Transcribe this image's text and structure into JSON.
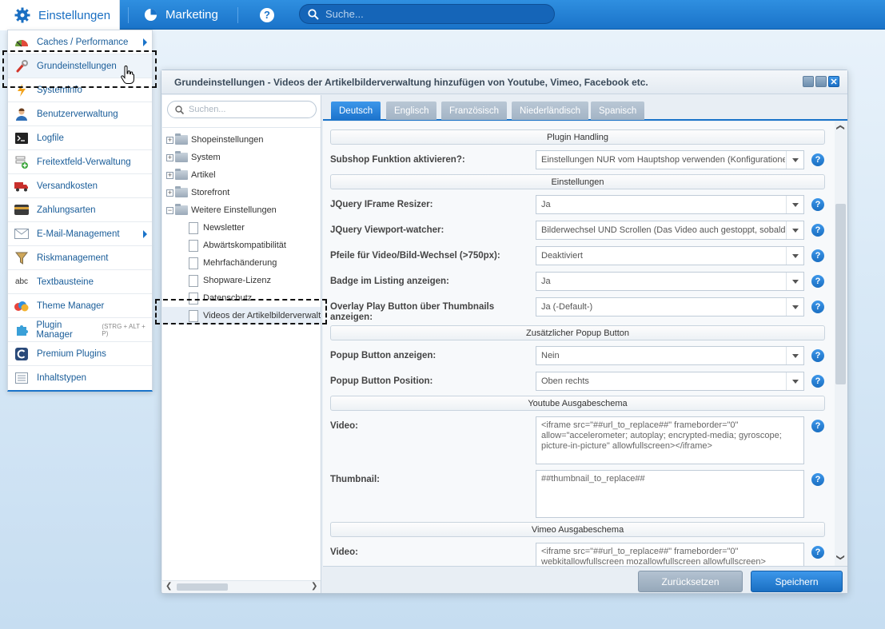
{
  "topbar": {
    "settings_label": "Einstellungen",
    "marketing_label": "Marketing",
    "help_label": "?",
    "search_placeholder": "Suche..."
  },
  "menu": {
    "items": [
      {
        "label": "Caches / Performance",
        "icon": "speedometer-icon",
        "has_submenu": true
      },
      {
        "label": "Grundeinstellungen",
        "icon": "wrench-icon",
        "has_submenu": false
      },
      {
        "label": "Systeminfo",
        "icon": "lightning-icon",
        "has_submenu": false
      },
      {
        "label": "Benutzerverwaltung",
        "icon": "user-icon",
        "has_submenu": false
      },
      {
        "label": "Logfile",
        "icon": "terminal-icon",
        "has_submenu": false
      },
      {
        "label": "Freitextfeld-Verwaltung",
        "icon": "form-add-icon",
        "has_submenu": false
      },
      {
        "label": "Versandkosten",
        "icon": "truck-icon",
        "has_submenu": false
      },
      {
        "label": "Zahlungsarten",
        "icon": "credit-card-icon",
        "has_submenu": false
      },
      {
        "label": "E-Mail-Management",
        "icon": "envelope-icon",
        "has_submenu": true
      },
      {
        "label": "Riskmanagement",
        "icon": "funnel-icon",
        "has_submenu": false
      },
      {
        "label": "Textbausteine",
        "icon": "abc-icon",
        "has_submenu": false
      },
      {
        "label": "Theme Manager",
        "icon": "palette-icon",
        "has_submenu": false
      },
      {
        "label": "Plugin Manager",
        "shortcut": "(STRG + ALT + P)",
        "icon": "puzzle-icon",
        "has_submenu": false
      },
      {
        "label": "Premium Plugins",
        "icon": "shopware-icon",
        "has_submenu": false
      },
      {
        "label": "Inhaltstypen",
        "icon": "list-icon",
        "has_submenu": false
      }
    ]
  },
  "window": {
    "title": "Grundeinstellungen - Videos der Artikelbilderverwaltung hinzufügen von Youtube, Vimeo, Facebook etc.",
    "close_label": "✕"
  },
  "tree": {
    "search_placeholder": "Suchen...",
    "nodes": [
      {
        "label": "Shopeinstellungen",
        "expander": "+"
      },
      {
        "label": "System",
        "expander": "+"
      },
      {
        "label": "Artikel",
        "expander": "+"
      },
      {
        "label": "Storefront",
        "expander": "+"
      },
      {
        "label": "Weitere Einstellungen",
        "expander": "−"
      }
    ],
    "children": [
      "Newsletter",
      "Abwärtskompatibilität",
      "Mehrfachänderung",
      "Shopware-Lizenz",
      "Datenschutz",
      "Videos der Artikelbilderverwalt"
    ]
  },
  "tabs": [
    "Deutsch",
    "Englisch",
    "Französisch",
    "Niederländisch",
    "Spanisch"
  ],
  "form": {
    "sections": {
      "plugin_handling": "Plugin Handling",
      "einstellungen": "Einstellungen",
      "popup": "Zusätzlicher Popup Button",
      "youtube": "Youtube Ausgabeschema",
      "vimeo": "Vimeo Ausgabeschema"
    },
    "fields": {
      "subshop": {
        "label": "Subshop Funktion aktivieren?:",
        "value": "Einstellungen NUR vom Hauptshop verwenden (Konfiguratione"
      },
      "iframe_resizer": {
        "label": "JQuery IFrame Resizer:",
        "value": "Ja"
      },
      "viewport_watcher": {
        "label": "JQuery Viewport-watcher:",
        "value": "Bilderwechsel UND Scrollen (Das Video auch gestoppt, sobald"
      },
      "pfeile": {
        "label": "Pfeile für Video/Bild-Wechsel (>750px):",
        "value": "Deaktiviert"
      },
      "badge": {
        "label": "Badge im Listing anzeigen:",
        "value": "Ja"
      },
      "overlay": {
        "label": "Overlay Play Button über Thumbnails anzeigen:",
        "value": "Ja (-Default-)"
      },
      "popup_show": {
        "label": "Popup Button anzeigen:",
        "value": "Nein"
      },
      "popup_pos": {
        "label": "Popup Button Position:",
        "value": "Oben rechts"
      },
      "yt_video": {
        "label": "Video:",
        "value": "<iframe src=\"##url_to_replace##\" frameborder=\"0\" allow=\"accelerometer; autoplay; encrypted-media; gyroscope; picture-in-picture\" allowfullscreen></iframe>"
      },
      "yt_thumb": {
        "label": "Thumbnail:",
        "value": "##thumbnail_to_replace##"
      },
      "vimeo_video": {
        "label": "Video:",
        "value": "<iframe src=\"##url_to_replace##\" frameborder=\"0\" webkitallowfullscreen mozallowfullscreen allowfullscreen>"
      }
    },
    "help_label": "?"
  },
  "buttons": {
    "reset": "Zurücksetzen",
    "save": "Speichern"
  },
  "colors": {
    "accent": "#1a73c9",
    "menu_text": "#1a5d99"
  }
}
